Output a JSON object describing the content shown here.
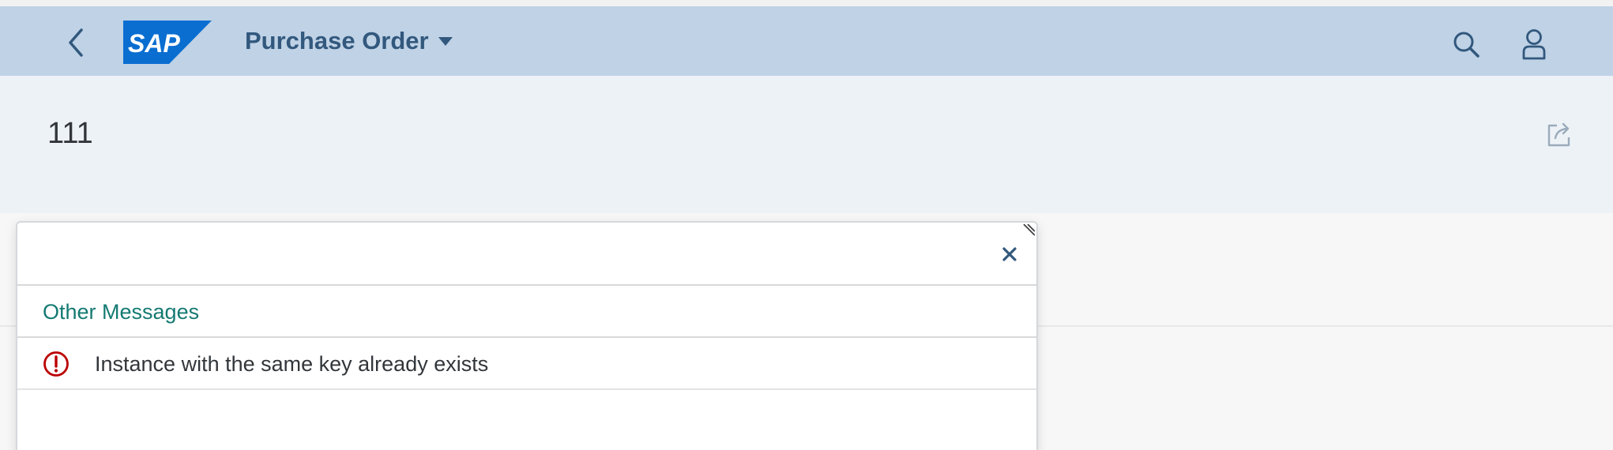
{
  "shell": {
    "title": "Purchase Order",
    "logo_text": "SAP",
    "colors": {
      "bar": "#bfd2e6",
      "icon": "#32587d",
      "logo": "#0a6ed1"
    }
  },
  "object": {
    "title": "111"
  },
  "message_popover": {
    "group_title": "Other Messages",
    "messages": [
      {
        "type": "error",
        "icon": "error-icon",
        "text": "Instance with the same key already exists"
      }
    ],
    "colors": {
      "group_title": "#147a72",
      "error": "#bb0000"
    }
  }
}
